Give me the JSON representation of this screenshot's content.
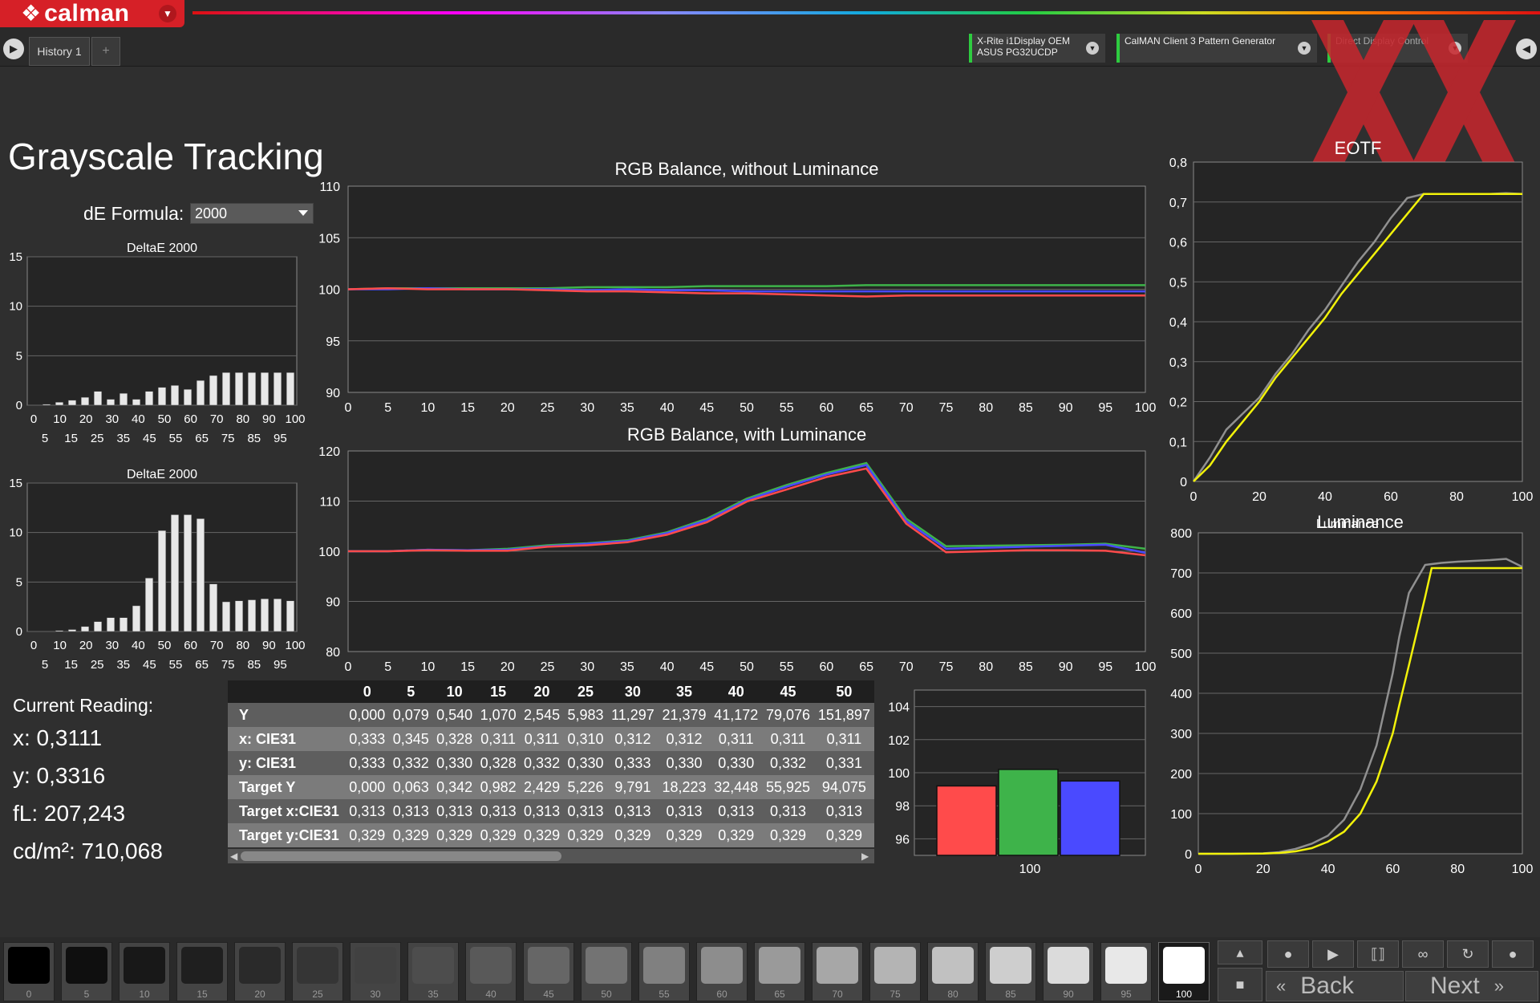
{
  "app": {
    "logo_mark": "❖",
    "logo_text": "calman"
  },
  "tabs": {
    "history": "History 1",
    "add": "+"
  },
  "devices": [
    {
      "line1": "X-Rite i1Display OEM",
      "line2": "ASUS PG32UCDP"
    },
    {
      "line1": "CalMAN Client 3 Pattern Generator",
      "line2": ""
    },
    {
      "line1": "Direct Display Control",
      "line2": ""
    }
  ],
  "page": {
    "title": "Grayscale Tracking",
    "de_formula_label": "dE Formula:",
    "de_formula_value": "2000"
  },
  "reading": {
    "title": "Current Reading:",
    "x": "x: 0,3111",
    "y": "y: 0,3316",
    "fl": "fL: 207,243",
    "cdm": "cd/m²: 710,068"
  },
  "colors": {
    "red": "#ff4b4b",
    "green": "#3eb34a",
    "blue": "#4a4aff",
    "yellow": "#f2f20a",
    "gray": "#909090"
  },
  "chart_data": [
    {
      "type": "bar",
      "title": "DeltaE 2000",
      "categories": [
        "0",
        "5",
        "10",
        "15",
        "20",
        "25",
        "30",
        "35",
        "40",
        "45",
        "50",
        "55",
        "60",
        "65",
        "70",
        "75",
        "80",
        "85",
        "90",
        "95",
        "100"
      ],
      "values": [
        0,
        0.1,
        0.3,
        0.5,
        0.8,
        1.4,
        0.6,
        1.2,
        0.6,
        1.4,
        1.8,
        2.0,
        1.6,
        2.5,
        3.0,
        3.3,
        3.3,
        3.3,
        3.3,
        3.3,
        3.3
      ],
      "ylim": [
        0,
        15
      ],
      "yticks": [
        0,
        5,
        10,
        15
      ],
      "xticks_top": [
        "0",
        "10",
        "20",
        "30",
        "40",
        "50",
        "60",
        "70",
        "80",
        "90",
        "100"
      ],
      "xticks_bottom": [
        "5",
        "15",
        "25",
        "35",
        "45",
        "55",
        "65",
        "75",
        "85",
        "95"
      ]
    },
    {
      "type": "bar",
      "title": "DeltaE 2000",
      "categories": [
        "0",
        "5",
        "10",
        "15",
        "20",
        "25",
        "30",
        "35",
        "40",
        "45",
        "50",
        "55",
        "60",
        "65",
        "70",
        "75",
        "80",
        "85",
        "90",
        "95",
        "100"
      ],
      "values": [
        0,
        0,
        0.1,
        0.2,
        0.5,
        1.0,
        1.4,
        1.4,
        2.6,
        5.4,
        10.2,
        11.8,
        11.8,
        11.4,
        4.8,
        3.0,
        3.1,
        3.2,
        3.3,
        3.3,
        3.1
      ],
      "ylim": [
        0,
        15
      ],
      "yticks": [
        0,
        5,
        10,
        15
      ],
      "xticks_top": [
        "0",
        "10",
        "20",
        "30",
        "40",
        "50",
        "60",
        "70",
        "80",
        "90",
        "100"
      ],
      "xticks_bottom": [
        "5",
        "15",
        "25",
        "35",
        "45",
        "55",
        "65",
        "75",
        "85",
        "95"
      ]
    },
    {
      "type": "line",
      "title": "RGB Balance, without Luminance",
      "x": [
        0,
        5,
        10,
        15,
        20,
        25,
        30,
        35,
        40,
        45,
        50,
        55,
        60,
        65,
        70,
        75,
        80,
        85,
        90,
        95,
        100
      ],
      "series": [
        {
          "color": "green",
          "values": [
            100,
            100.1,
            100.1,
            100.1,
            100.1,
            100.1,
            100.2,
            100.2,
            100.2,
            100.3,
            100.3,
            100.3,
            100.3,
            100.4,
            100.4,
            100.4,
            100.4,
            100.4,
            100.4,
            100.4,
            100.4
          ]
        },
        {
          "color": "blue",
          "values": [
            100,
            100,
            100.1,
            100,
            100,
            100,
            99.9,
            100,
            99.9,
            99.9,
            99.8,
            99.8,
            99.8,
            99.8,
            99.8,
            99.8,
            99.8,
            99.8,
            99.8,
            99.8,
            99.8
          ]
        },
        {
          "color": "red",
          "values": [
            100,
            100.1,
            100,
            100,
            100,
            99.9,
            99.8,
            99.8,
            99.7,
            99.6,
            99.6,
            99.5,
            99.4,
            99.3,
            99.4,
            99.4,
            99.4,
            99.4,
            99.4,
            99.4,
            99.4
          ]
        }
      ],
      "ylim": [
        90,
        110
      ],
      "yticks": [
        90,
        95,
        100,
        105,
        110
      ],
      "xticks": [
        0,
        5,
        10,
        15,
        20,
        25,
        30,
        35,
        40,
        45,
        50,
        55,
        60,
        65,
        70,
        75,
        80,
        85,
        90,
        95,
        100
      ]
    },
    {
      "type": "line",
      "title": "RGB Balance, with Luminance",
      "x": [
        0,
        5,
        10,
        15,
        20,
        25,
        30,
        35,
        40,
        45,
        50,
        55,
        60,
        65,
        70,
        75,
        80,
        85,
        90,
        95,
        100
      ],
      "series": [
        {
          "color": "green",
          "values": [
            100,
            100,
            100.3,
            100.2,
            100.5,
            101.2,
            101.6,
            102.2,
            103.8,
            106.5,
            110.5,
            113.2,
            115.6,
            117.6,
            106.5,
            101,
            101.1,
            101.2,
            101.3,
            101.5,
            100.5
          ]
        },
        {
          "color": "blue",
          "values": [
            100,
            100,
            100.3,
            100.2,
            100.3,
            101,
            101.5,
            102,
            103.6,
            106.2,
            110.2,
            112.9,
            115.3,
            117.2,
            106,
            100.5,
            100.7,
            100.9,
            101.1,
            101.3,
            99.7
          ]
        },
        {
          "color": "red",
          "values": [
            100,
            100,
            100.2,
            100.1,
            100.1,
            100.9,
            101.2,
            101.8,
            103.3,
            105.8,
            109.9,
            112.3,
            114.8,
            116.5,
            105.5,
            99.8,
            100,
            100.2,
            100.2,
            100.1,
            99.2
          ]
        }
      ],
      "ylim": [
        80,
        120
      ],
      "yticks": [
        80,
        90,
        100,
        110,
        120
      ],
      "xticks": [
        0,
        5,
        10,
        15,
        20,
        25,
        30,
        35,
        40,
        45,
        50,
        55,
        60,
        65,
        70,
        75,
        80,
        85,
        90,
        95,
        100
      ]
    },
    {
      "type": "bar",
      "title": "",
      "categories": [
        "100"
      ],
      "series": [
        {
          "color": "red",
          "value": 99.2
        },
        {
          "color": "green",
          "value": 100.2
        },
        {
          "color": "blue",
          "value": 99.5
        }
      ],
      "ylim": [
        95,
        105
      ],
      "yticks": [
        96,
        98,
        100,
        102,
        104
      ]
    },
    {
      "type": "line",
      "title": "EOTF",
      "x": [
        0,
        5,
        10,
        15,
        20,
        25,
        30,
        35,
        40,
        45,
        50,
        55,
        60,
        65,
        70,
        72,
        75,
        80,
        85,
        90,
        95,
        100
      ],
      "series": [
        {
          "color": "gray",
          "values": [
            0,
            0.06,
            0.13,
            0.17,
            0.21,
            0.27,
            0.32,
            0.38,
            0.43,
            0.49,
            0.55,
            0.6,
            0.66,
            0.71,
            0.72,
            0.72,
            0.72,
            0.72,
            0.72,
            0.72,
            0.722,
            0.72
          ]
        },
        {
          "color": "yellow",
          "values": [
            0,
            0.04,
            0.1,
            0.15,
            0.2,
            0.26,
            0.31,
            0.36,
            0.41,
            0.47,
            0.52,
            0.57,
            0.62,
            0.67,
            0.72,
            0.72,
            0.72,
            0.72,
            0.72,
            0.72,
            0.72,
            0.72
          ]
        }
      ],
      "ylim": [
        0,
        0.8
      ],
      "yticks": [
        "0",
        "0,1",
        "0,2",
        "0,3",
        "0,4",
        "0,5",
        "0,6",
        "0,7",
        "0,8"
      ],
      "xlim": [
        0,
        100
      ],
      "xticks": [
        0,
        20,
        40,
        60,
        80,
        100
      ]
    },
    {
      "type": "line",
      "title": "Luminance",
      "x": [
        0,
        10,
        20,
        25,
        30,
        35,
        40,
        45,
        50,
        55,
        60,
        62,
        65,
        70,
        72,
        75,
        80,
        85,
        90,
        95,
        100
      ],
      "series": [
        {
          "color": "gray",
          "values": [
            0,
            0.1,
            1,
            4,
            12,
            25,
            45,
            85,
            160,
            270,
            450,
            540,
            650,
            720,
            722,
            725,
            728,
            730,
            732,
            735,
            715
          ]
        },
        {
          "color": "yellow",
          "values": [
            0,
            0.1,
            0.5,
            2,
            6,
            14,
            30,
            55,
            100,
            180,
            300,
            370,
            470,
            640,
            712,
            712,
            712,
            712,
            712,
            712,
            712
          ]
        }
      ],
      "ylim": [
        0,
        800
      ],
      "yticks": [
        0,
        100,
        200,
        300,
        400,
        500,
        600,
        700,
        800
      ],
      "xlim": [
        0,
        100
      ],
      "xticks": [
        0,
        20,
        40,
        60,
        80,
        100
      ]
    }
  ],
  "table": {
    "columns": [
      "",
      "0",
      "5",
      "10",
      "15",
      "20",
      "25",
      "30",
      "35",
      "40",
      "45",
      "50"
    ],
    "rows": [
      [
        "Y",
        "0,000",
        "0,079",
        "0,540",
        "1,070",
        "2,545",
        "5,983",
        "11,297",
        "21,379",
        "41,172",
        "79,076",
        "151,897"
      ],
      [
        "x: CIE31",
        "0,333",
        "0,345",
        "0,328",
        "0,311",
        "0,311",
        "0,310",
        "0,312",
        "0,312",
        "0,311",
        "0,311",
        "0,311"
      ],
      [
        "y: CIE31",
        "0,333",
        "0,332",
        "0,330",
        "0,328",
        "0,332",
        "0,330",
        "0,333",
        "0,330",
        "0,330",
        "0,332",
        "0,331"
      ],
      [
        "Target Y",
        "0,000",
        "0,063",
        "0,342",
        "0,982",
        "2,429",
        "5,226",
        "9,791",
        "18,223",
        "32,448",
        "55,925",
        "94,075"
      ],
      [
        "Target x:CIE31",
        "0,313",
        "0,313",
        "0,313",
        "0,313",
        "0,313",
        "0,313",
        "0,313",
        "0,313",
        "0,313",
        "0,313",
        "0,313"
      ],
      [
        "Target y:CIE31",
        "0,329",
        "0,329",
        "0,329",
        "0,329",
        "0,329",
        "0,329",
        "0,329",
        "0,329",
        "0,329",
        "0,329",
        "0,329"
      ]
    ]
  },
  "swatches": [
    {
      "label": "0",
      "color": "#000000"
    },
    {
      "label": "5",
      "color": "#0f0f0f"
    },
    {
      "label": "10",
      "color": "#181818"
    },
    {
      "label": "15",
      "color": "#1f1f1f"
    },
    {
      "label": "20",
      "color": "#2a2a2a"
    },
    {
      "label": "25",
      "color": "#353535"
    },
    {
      "label": "30",
      "color": "#414141"
    },
    {
      "label": "35",
      "color": "#4d4d4d"
    },
    {
      "label": "40",
      "color": "#595959"
    },
    {
      "label": "45",
      "color": "#666666"
    },
    {
      "label": "50",
      "color": "#737373"
    },
    {
      "label": "55",
      "color": "#808080"
    },
    {
      "label": "60",
      "color": "#8d8d8d"
    },
    {
      "label": "65",
      "color": "#9a9a9a"
    },
    {
      "label": "70",
      "color": "#a7a7a7"
    },
    {
      "label": "75",
      "color": "#b4b4b4"
    },
    {
      "label": "80",
      "color": "#c1c1c1"
    },
    {
      "label": "85",
      "color": "#cecece"
    },
    {
      "label": "90",
      "color": "#dbdbdb"
    },
    {
      "label": "95",
      "color": "#e8e8e8"
    },
    {
      "label": "100",
      "color": "#ffffff"
    }
  ],
  "nav": {
    "back": "Back",
    "next": "Next"
  }
}
